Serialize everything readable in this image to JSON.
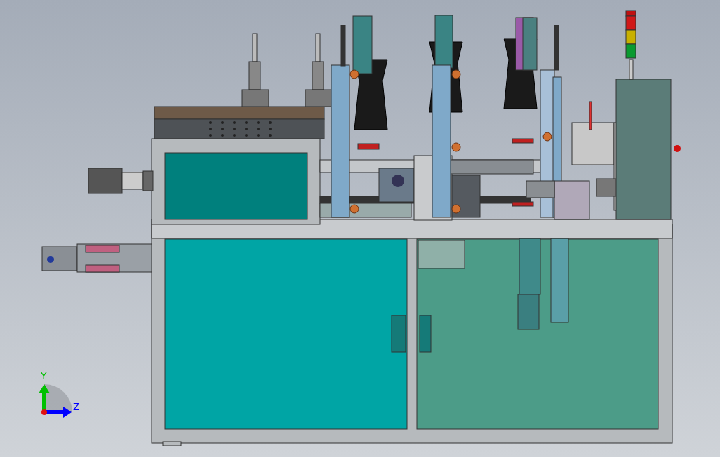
{
  "viewport": {
    "triad": {
      "axes": [
        {
          "label": "Y",
          "kind": "vertical",
          "color": "#00c000"
        },
        {
          "label": "Z",
          "kind": "horizontal",
          "color": "#0000ff"
        }
      ]
    }
  }
}
